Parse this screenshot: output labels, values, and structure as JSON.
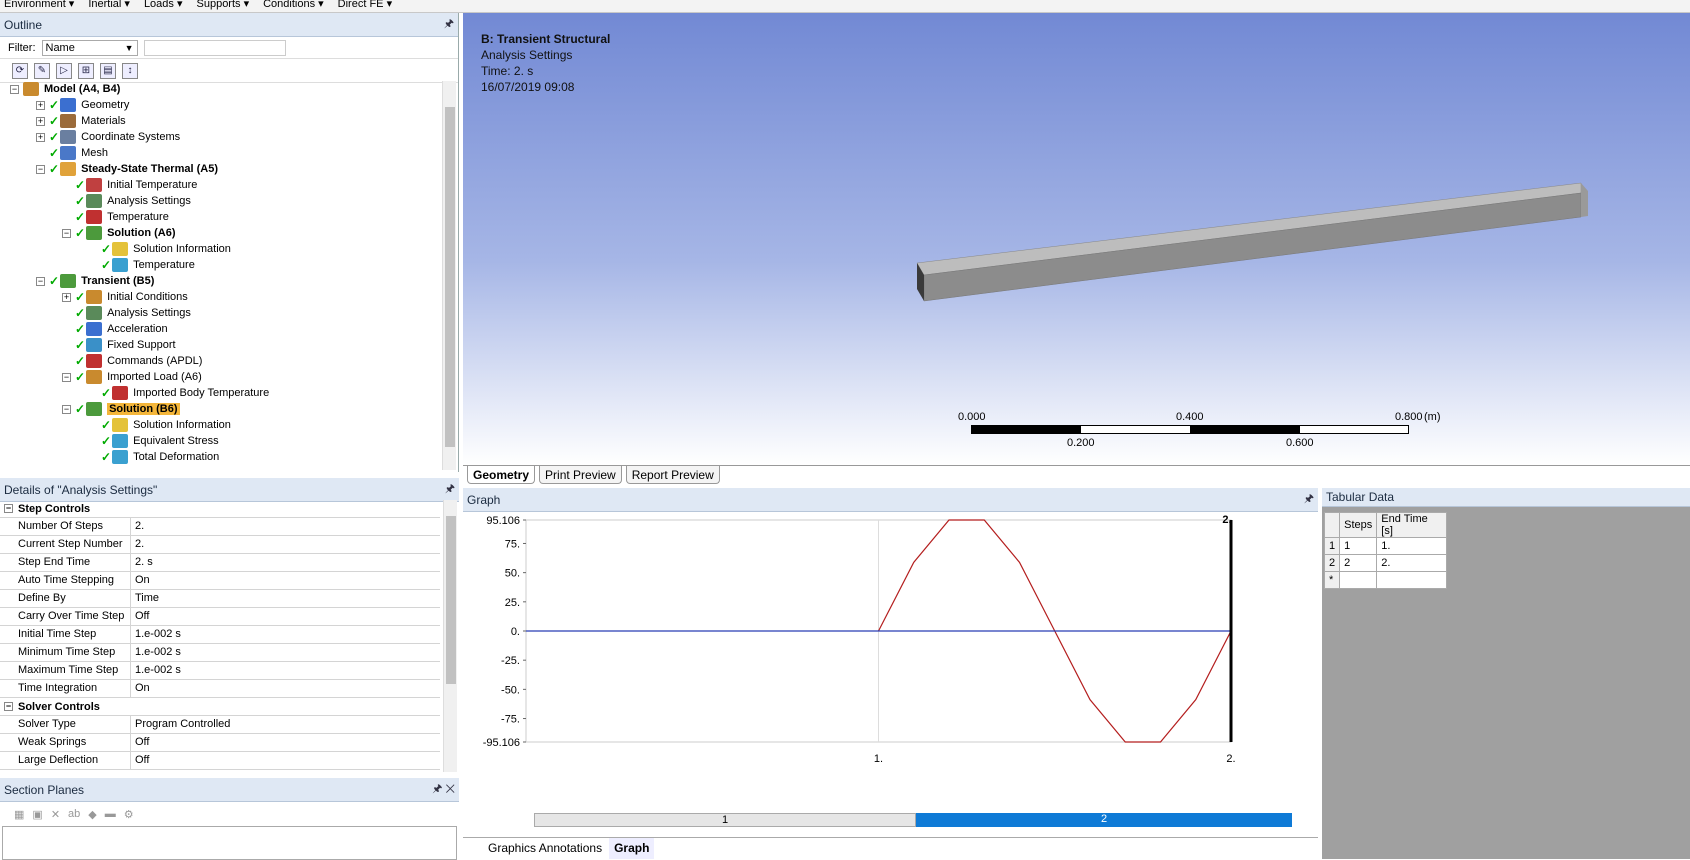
{
  "menubar": [
    "Environment",
    "Inertial",
    "Loads",
    "Supports",
    "Conditions",
    "Direct FE"
  ],
  "outline": {
    "title": "Outline",
    "filter_label": "Filter:",
    "filter_value": "Name",
    "tree": [
      {
        "label": "Model (A4, B4)",
        "bold": true
      },
      {
        "label": "Geometry"
      },
      {
        "label": "Materials"
      },
      {
        "label": "Coordinate Systems"
      },
      {
        "label": "Mesh"
      },
      {
        "label": "Steady-State Thermal (A5)",
        "bold": true
      },
      {
        "label": "Initial Temperature"
      },
      {
        "label": "Analysis Settings"
      },
      {
        "label": "Temperature"
      },
      {
        "label": "Solution (A6)",
        "bold": true
      },
      {
        "label": "Solution Information"
      },
      {
        "label": "Temperature"
      },
      {
        "label": "Transient (B5)",
        "bold": true
      },
      {
        "label": "Initial Conditions"
      },
      {
        "label": "Analysis Settings"
      },
      {
        "label": "Acceleration"
      },
      {
        "label": "Fixed Support"
      },
      {
        "label": "Commands (APDL)"
      },
      {
        "label": "Imported Load (A6)"
      },
      {
        "label": "Imported Body Temperature"
      },
      {
        "label": "Solution (B6)",
        "bold": true,
        "selected": true
      },
      {
        "label": "Solution Information"
      },
      {
        "label": "Equivalent Stress"
      },
      {
        "label": "Total Deformation"
      }
    ]
  },
  "details": {
    "title": "Details of \"Analysis Settings\"",
    "sections": [
      {
        "name": "Step Controls",
        "rows": [
          [
            "Number Of Steps",
            "2."
          ],
          [
            "Current Step Number",
            "2."
          ],
          [
            "Step End Time",
            "2. s"
          ],
          [
            "Auto Time Stepping",
            "On"
          ],
          [
            "Define By",
            "Time"
          ],
          [
            "Carry Over Time Step",
            "Off"
          ],
          [
            "Initial Time Step",
            "1.e-002 s"
          ],
          [
            "Minimum Time Step",
            "1.e-002 s"
          ],
          [
            "Maximum Time Step",
            "1.e-002 s"
          ],
          [
            "Time Integration",
            "On"
          ]
        ]
      },
      {
        "name": "Solver Controls",
        "rows": [
          [
            "Solver Type",
            "Program Controlled"
          ],
          [
            "Weak Springs",
            "Off"
          ],
          [
            "Large Deflection",
            "Off"
          ]
        ]
      }
    ]
  },
  "section_planes": {
    "title": "Section Planes"
  },
  "viewport": {
    "title": "B: Transient Structural",
    "subtitle": "Analysis Settings",
    "time": "Time: 2. s",
    "date": "16/07/2019 09:08",
    "scale_labels_top": [
      "0.000",
      "0.400",
      "0.800"
    ],
    "scale_unit": "(m)",
    "scale_labels_bottom": [
      "0.200",
      "0.600"
    ]
  },
  "view_tabs": [
    "Geometry",
    "Print Preview",
    "Report Preview"
  ],
  "graph": {
    "title": "Graph",
    "time_marker": "2.",
    "bottom_tabs": [
      "Graphics Annotations",
      "Graph"
    ],
    "steps_bar": [
      "1",
      "2"
    ]
  },
  "chart_data": {
    "type": "line",
    "ylim": [
      -95.106,
      95.106
    ],
    "yticks": [
      "95.106",
      "75.",
      "50.",
      "25.",
      "0.",
      "-25.",
      "-50.",
      "-75.",
      "-95.106"
    ],
    "xticks": [
      "1.",
      "2."
    ],
    "xlim": [
      0,
      2
    ],
    "series": [
      {
        "color": "#b41e1e",
        "x": [
          1.0,
          1.1,
          1.2,
          1.3,
          1.4,
          1.5,
          1.6,
          1.7,
          1.8,
          1.9,
          2.0
        ],
        "y": [
          0,
          58.8,
          95.106,
          95.106,
          58.8,
          0,
          -58.8,
          -95.106,
          -95.106,
          -58.8,
          0
        ]
      },
      {
        "color": "#283cb4",
        "x": [
          0,
          2
        ],
        "y": [
          0,
          0
        ]
      }
    ]
  },
  "tabular": {
    "title": "Tabular Data",
    "headers": [
      "Steps",
      "End Time [s]"
    ],
    "rows": [
      [
        "1",
        "1",
        "1."
      ],
      [
        "2",
        "2",
        "2."
      ],
      [
        "*",
        "",
        ""
      ]
    ]
  }
}
